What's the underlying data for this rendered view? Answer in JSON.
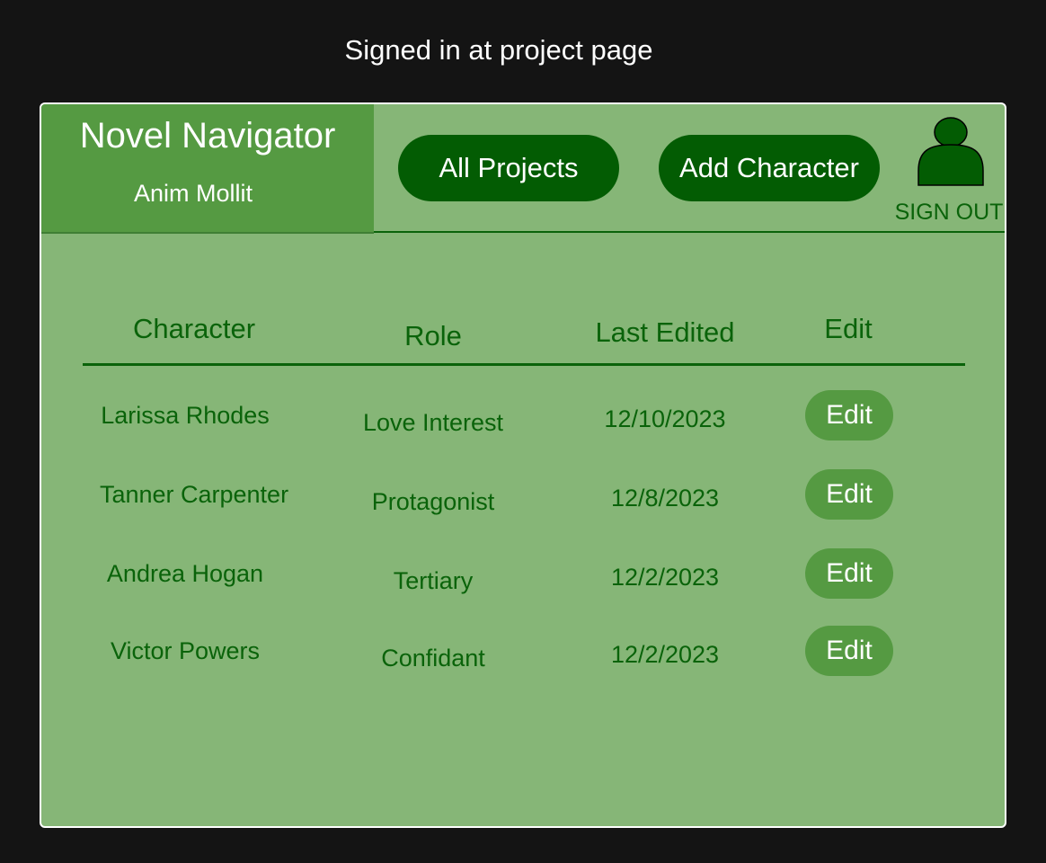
{
  "caption": "Signed in at project page",
  "header": {
    "app_title": "Novel Navigator",
    "user_name": "Anim Mollit",
    "all_projects_label": "All Projects",
    "add_character_label": "Add Character",
    "sign_out_label": "SIGN OUT",
    "sign_out_icon": "user-icon"
  },
  "table": {
    "columns": [
      "Character",
      "Role",
      "Last Edited",
      "Edit"
    ],
    "rows": [
      {
        "character": "Larissa Rhodes",
        "role": "Love Interest",
        "last_edited": "12/10/2023",
        "edit_label": "Edit"
      },
      {
        "character": "Tanner Carpenter",
        "role": "Protagonist",
        "last_edited": "12/8/2023",
        "edit_label": "Edit"
      },
      {
        "character": "Andrea Hogan",
        "role": "Tertiary",
        "last_edited": "12/2/2023",
        "edit_label": "Edit"
      },
      {
        "character": "Victor Powers",
        "role": "Confidant",
        "last_edited": "12/2/2023",
        "edit_label": "Edit"
      }
    ]
  },
  "colors": {
    "background": "#141414",
    "panel": "#86b677",
    "brand_panel": "#559a42",
    "dark_green": "#035c03",
    "text_green": "#0a630a",
    "white": "#ffffff"
  }
}
